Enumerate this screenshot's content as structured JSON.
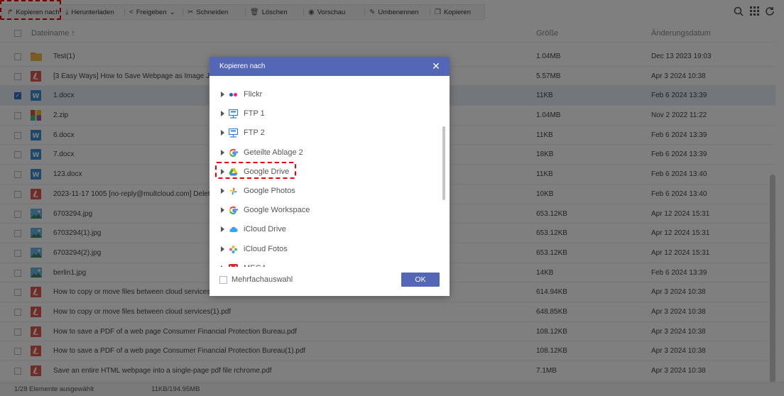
{
  "toolbar": {
    "buttons": [
      {
        "label": "Kopieren nach",
        "icon": "share-arrow-icon"
      },
      {
        "label": "Herunterladen",
        "icon": "download-icon"
      },
      {
        "label": "Freigeben",
        "icon": "share-icon"
      },
      {
        "label": "Schneiden",
        "icon": "scissors-icon"
      },
      {
        "label": "Löschen",
        "icon": "trash-icon"
      },
      {
        "label": "Vorschau",
        "icon": "eye-icon"
      },
      {
        "label": "Umbenennen",
        "icon": "pencil-icon"
      },
      {
        "label": "Kopieren",
        "icon": "copy-icon"
      }
    ],
    "freigeben_caret": "⌄"
  },
  "table": {
    "headers": {
      "name": "Dateiname",
      "sort_indicator": "↑",
      "size": "Größe",
      "date": "Änderungsdatum"
    },
    "rows": [
      {
        "name": "Test(1)",
        "size": "1.04MB",
        "date": "Dec 13 2023 19:03",
        "type": "folder",
        "checked": false
      },
      {
        "name": "[3 Easy Ways] How to Save Webpage as Image JPEG",
        "size": "5.57MB",
        "date": "Apr 3 2024 10:38",
        "type": "pdf",
        "checked": false
      },
      {
        "name": "1.docx",
        "size": "11KB",
        "date": "Feb 6 2024 13:39",
        "type": "docx",
        "checked": true
      },
      {
        "name": "2.zip",
        "size": "1.04MB",
        "date": "Nov 2 2022 11:22",
        "type": "zip",
        "checked": false
      },
      {
        "name": "6.docx",
        "size": "11KB",
        "date": "Feb 6 2024 13:39",
        "type": "docx",
        "checked": false
      },
      {
        "name": "7.docx",
        "size": "18KB",
        "date": "Feb 6 2024 13:39",
        "type": "docx",
        "checked": false
      },
      {
        "name": "123.docx",
        "size": "11KB",
        "date": "Feb 6 2024 13:40",
        "type": "docx",
        "checked": false
      },
      {
        "name": "2023-11-17 1005 [no-reply@multcloud.com] Delete M",
        "size": "10KB",
        "date": "Feb 6 2024 13:40",
        "type": "pdf",
        "checked": false
      },
      {
        "name": "6703294.jpg",
        "size": "653.12KB",
        "date": "Apr 12 2024 15:31",
        "type": "image",
        "checked": false
      },
      {
        "name": "6703294(1).jpg",
        "size": "653.12KB",
        "date": "Apr 12 2024 15:31",
        "type": "image",
        "checked": false
      },
      {
        "name": "6703294(2).jpg",
        "size": "653.12KB",
        "date": "Apr 12 2024 15:31",
        "type": "image",
        "checked": false
      },
      {
        "name": "berlin1.jpg",
        "size": "14KB",
        "date": "Feb 6 2024 13:39",
        "type": "image",
        "checked": false
      },
      {
        "name": "How to copy or move files between cloud services.pdf",
        "size": "614.94KB",
        "date": "Apr 3 2024 10:38",
        "type": "pdf",
        "checked": false
      },
      {
        "name": "How to copy or move files between cloud services(1).pdf",
        "size": "648.85KB",
        "date": "Apr 3 2024 10:38",
        "type": "pdf",
        "checked": false
      },
      {
        "name": "How to save a PDF of a web page Consumer Financial Protection Bureau.pdf",
        "size": "108.12KB",
        "date": "Apr 3 2024 10:38",
        "type": "pdf",
        "checked": false
      },
      {
        "name": "How to save a PDF of a web page Consumer Financial Protection Bureau(1).pdf",
        "size": "108.12KB",
        "date": "Apr 3 2024 10:38",
        "type": "pdf",
        "checked": false
      },
      {
        "name": "Save an entire HTML webpage into a single-page pdf file rchrome.pdf",
        "size": "7.1MB",
        "date": "Apr 3 2024 10:38",
        "type": "pdf",
        "checked": false
      }
    ]
  },
  "footer": {
    "selected": "1/28 Elemente ausgewählt",
    "sizes": "11KB/194.95MB"
  },
  "dialog": {
    "title": "Kopieren nach",
    "items": [
      {
        "label": "Flickr",
        "icon": "flickr-icon"
      },
      {
        "label": "FTP 1",
        "icon": "ftp-icon"
      },
      {
        "label": "FTP 2",
        "icon": "ftp-icon"
      },
      {
        "label": "Geteilte Ablage 2",
        "icon": "google-icon"
      },
      {
        "label": "Google Drive",
        "icon": "google-drive-icon"
      },
      {
        "label": "Google Photos",
        "icon": "google-photos-icon"
      },
      {
        "label": "Google Workspace",
        "icon": "google-icon"
      },
      {
        "label": "iCloud Drive",
        "icon": "icloud-icon"
      },
      {
        "label": "iCloud Fotos",
        "icon": "icloud-photos-icon"
      },
      {
        "label": "MEGA",
        "icon": "mega-icon"
      }
    ],
    "multi_select": "Mehrfachauswahl",
    "ok": "OK"
  },
  "colors": {
    "accent": "#5466b6",
    "highlight": "#e00000",
    "selected_row": "#e6ecf6"
  }
}
